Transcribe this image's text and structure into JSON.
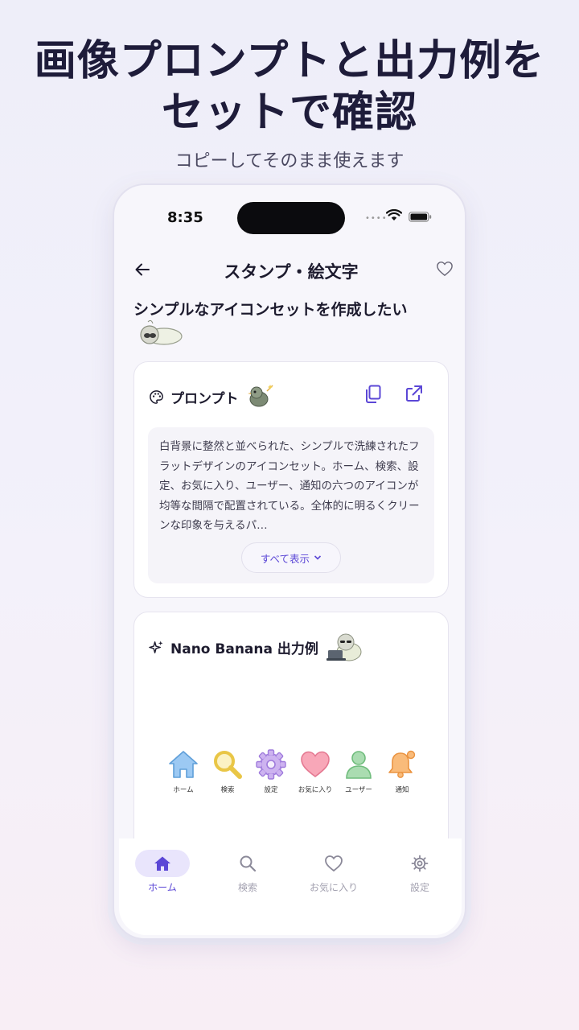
{
  "headline": {
    "line1": "画像プロンプトと出力例を",
    "line2": "セットで確認"
  },
  "subheadline": "コピーしてそのまま使えます",
  "status_bar": {
    "time": "8:35",
    "signal": "••••"
  },
  "nav": {
    "title": "スタンプ・絵文字"
  },
  "page_title": "シンプルなアイコンセットを作成したい",
  "prompt_card": {
    "label": "プロンプト",
    "text": "白背景に整然と並べられた、シンプルで洗練されたフラットデザインのアイコンセット。ホーム、検索、設定、お気に入り、ユーザー、通知の六つのアイコンが均等な間隔で配置されている。全体的に明るくクリーンな印象を与えるパ…",
    "show_all": "すべて表示"
  },
  "output_card": {
    "label": "Nano Banana 出力例",
    "icons": [
      {
        "name": "home-icon",
        "label": "ホーム",
        "color": "#8fc3f2"
      },
      {
        "name": "search-icon",
        "label": "検索",
        "color": "#f5d76e"
      },
      {
        "name": "gear-icon",
        "label": "設定",
        "color": "#c6a8ee"
      },
      {
        "name": "heart-icon",
        "label": "お気に入り",
        "color": "#f6a1b3"
      },
      {
        "name": "user-icon",
        "label": "ユーザー",
        "color": "#a7dcae"
      },
      {
        "name": "bell-icon",
        "label": "通知",
        "color": "#f8b26a"
      }
    ]
  },
  "tabbar": {
    "tabs": [
      {
        "label": "ホーム",
        "icon": "home-icon",
        "active": true
      },
      {
        "label": "検索",
        "icon": "search-icon",
        "active": false
      },
      {
        "label": "お気に入り",
        "icon": "heart-icon",
        "active": false
      },
      {
        "label": "設定",
        "icon": "gear-icon",
        "active": false
      }
    ]
  },
  "colors": {
    "accent": "#5b47d6",
    "accent_light": "#e9e5fc",
    "tab_inactive": "#a3a1b0"
  }
}
